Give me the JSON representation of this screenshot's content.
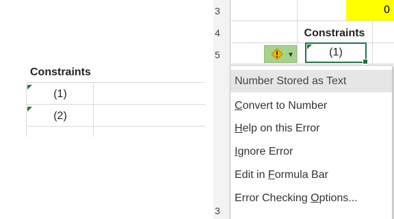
{
  "left": {
    "header": "Constraints",
    "cells": [
      "(1)",
      "(2)"
    ]
  },
  "right": {
    "row_numbers": [
      "3",
      "4",
      "5",
      "3"
    ],
    "yellow_value": "0",
    "header": "Constraints",
    "selected_value": "(1)",
    "error_icon": "warning-diamond-icon",
    "menu": {
      "title": "Number Stored as Text",
      "items": [
        {
          "pre": "",
          "key": "C",
          "post": "onvert to Number"
        },
        {
          "pre": "",
          "key": "H",
          "post": "elp on this Error"
        },
        {
          "pre": "",
          "key": "I",
          "post": "gnore Error"
        },
        {
          "pre": "Edit in ",
          "key": "F",
          "post": "ormula Bar"
        },
        {
          "pre": "Error Checking ",
          "key": "O",
          "post": "ptions..."
        }
      ]
    }
  },
  "colors": {
    "accent": "#217346",
    "error_triangle": "#1e7b34",
    "highlight_yellow": "#ffff00",
    "menu_header": "#e6e6e6"
  }
}
